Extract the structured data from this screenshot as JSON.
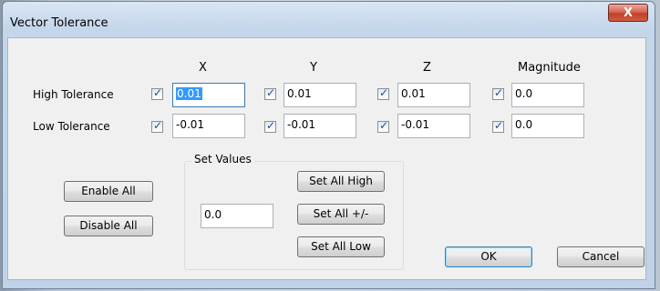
{
  "window": {
    "title": "Vector Tolerance",
    "close_label": "X"
  },
  "columns": {
    "x": "X",
    "y": "Y",
    "z": "Z",
    "magnitude": "Magnitude"
  },
  "rows": {
    "high": {
      "label": "High Tolerance",
      "x": {
        "checked": true,
        "value": "0.01"
      },
      "y": {
        "checked": true,
        "value": "0.01"
      },
      "z": {
        "checked": true,
        "value": "0.01"
      },
      "magnitude": {
        "checked": true,
        "value": "0.0"
      }
    },
    "low": {
      "label": "Low Tolerance",
      "x": {
        "checked": true,
        "value": "-0.01"
      },
      "y": {
        "checked": true,
        "value": "-0.01"
      },
      "z": {
        "checked": true,
        "value": "-0.01"
      },
      "magnitude": {
        "checked": true,
        "value": "0.0"
      }
    }
  },
  "buttons": {
    "enable_all": "Enable All",
    "disable_all": "Disable All",
    "ok": "OK",
    "cancel": "Cancel"
  },
  "set_values": {
    "title": "Set Values",
    "value": "0.0",
    "set_all_high": "Set All High",
    "set_all_pm": "Set All +/-",
    "set_all_low": "Set All Low"
  }
}
